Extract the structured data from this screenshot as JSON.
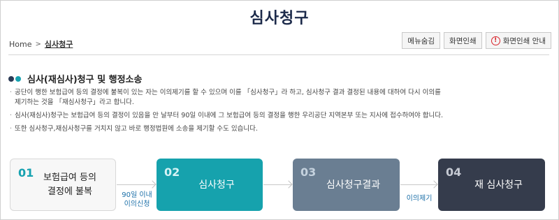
{
  "page": {
    "title": "심사청구"
  },
  "breadcrumb": {
    "home": "Home",
    "current": "심사청구"
  },
  "toolbar": {
    "hide_menu": "메뉴숨김",
    "print": "화면인쇄",
    "print_guide": "화면인쇄 안내"
  },
  "section": {
    "title": "심사(재심사)청구 및 행정소송",
    "bullets": [
      "공단이 행한 보험급여 등의 결정에 불복이 있는 자는 이의제기를 할 수 있으며 이를 「심사청구」라 하고, 심사청구 결과 결정된 내용에 대하여 다시 이의를",
      "제기하는 것을 「재심사청구」라고 합니다.",
      "심사(재심사)청구는 보험급여 등의 결정이 있음을 안 날부터 90일 이내에 그 보험급여 등의 결정을 행한 우리공단 지역본부 또는 지사에 접수하여야 합니다.",
      "또한 심사청구,재심사청구를 거치지 않고 바로 행정법원에 소송을 제기할 수도 있습니다."
    ]
  },
  "steps": [
    {
      "num": "01",
      "label": "보험급여 등의\n결정에 불복"
    },
    {
      "num": "02",
      "label": "심사청구"
    },
    {
      "num": "03",
      "label": "심사청구결과"
    },
    {
      "num": "04",
      "label": "재 심사청구"
    }
  ],
  "captions": {
    "first": "90일 이내\n이의신청",
    "third": "이의제기"
  },
  "colors": {
    "accent_teal": "#16a2ad",
    "slate": "#6a7e92",
    "dark": "#353c4c",
    "dot_dark": "#2b3a55",
    "dot_teal": "#17a2b0"
  }
}
